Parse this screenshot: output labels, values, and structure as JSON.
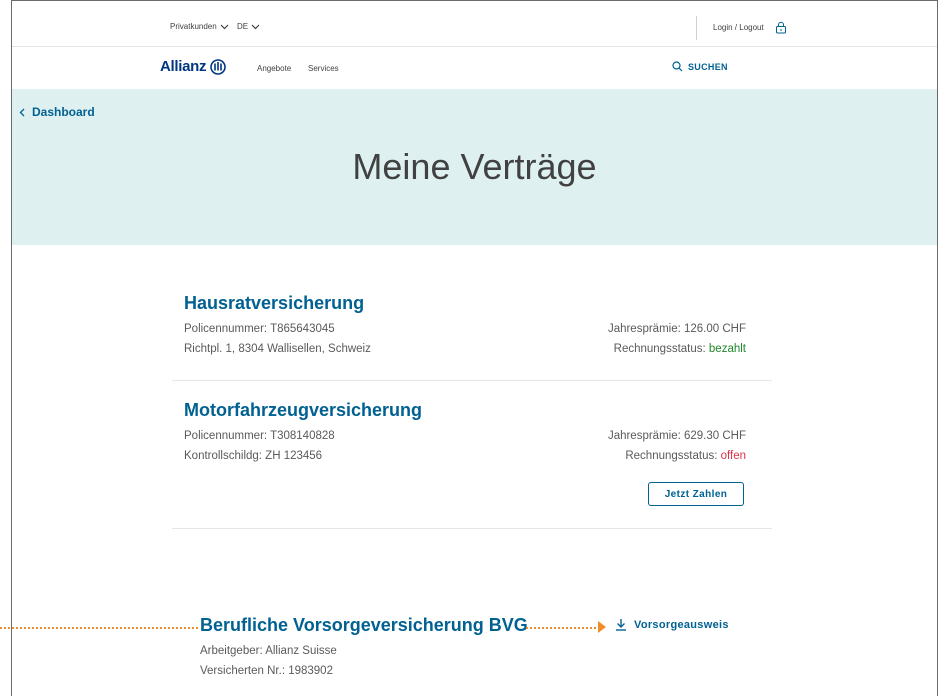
{
  "topbar": {
    "segment_label": "Privatkunden",
    "language_label": "DE",
    "login_label": "Login / Logout"
  },
  "nav": {
    "brand": "Allianz",
    "links": [
      "Angebote",
      "Services"
    ],
    "search_label": "SUCHEN"
  },
  "hero": {
    "back_label": "Dashboard",
    "title": "Meine Verträge"
  },
  "contracts": [
    {
      "title": "Hausratversicherung",
      "line1": "Policennummer: T865643045",
      "line2": "Richtpl. 1, 8304 Wallisellen, Schweiz",
      "premium": "Jahresprämie: 126.00 CHF",
      "status_label": "Rechnungsstatus: ",
      "status_value": "bezahlt"
    },
    {
      "title": "Motorfahrzeugversicherung",
      "line1": "Policennummer: T308140828",
      "line2": "Kontrollschildg: ZH 123456",
      "premium": "Jahresprämie: 629.30 CHF",
      "status_label": "Rechnungsstatus: ",
      "status_value": "offen",
      "pay_button": "Jetzt Zahlen"
    }
  ],
  "bvg": {
    "title": "Berufliche Vorsorgeversicherung BVG",
    "employer": "Arbeitgeber: Allianz Suisse",
    "insured_no": "Versicherten Nr.: 1983902",
    "download_label": "Vorsorgeausweis"
  },
  "colors": {
    "brand_blue": "#003781",
    "link_blue": "#006192",
    "hero_bg": "#dff0f1",
    "paid_green": "#1e8927",
    "open_red": "#dc3149",
    "annotation_orange": "#f28c28"
  },
  "icons": {
    "chevron": "chevron-down-icon",
    "lock": "lock-icon",
    "search": "search-icon",
    "back": "chevron-left-icon",
    "download": "download-icon"
  }
}
